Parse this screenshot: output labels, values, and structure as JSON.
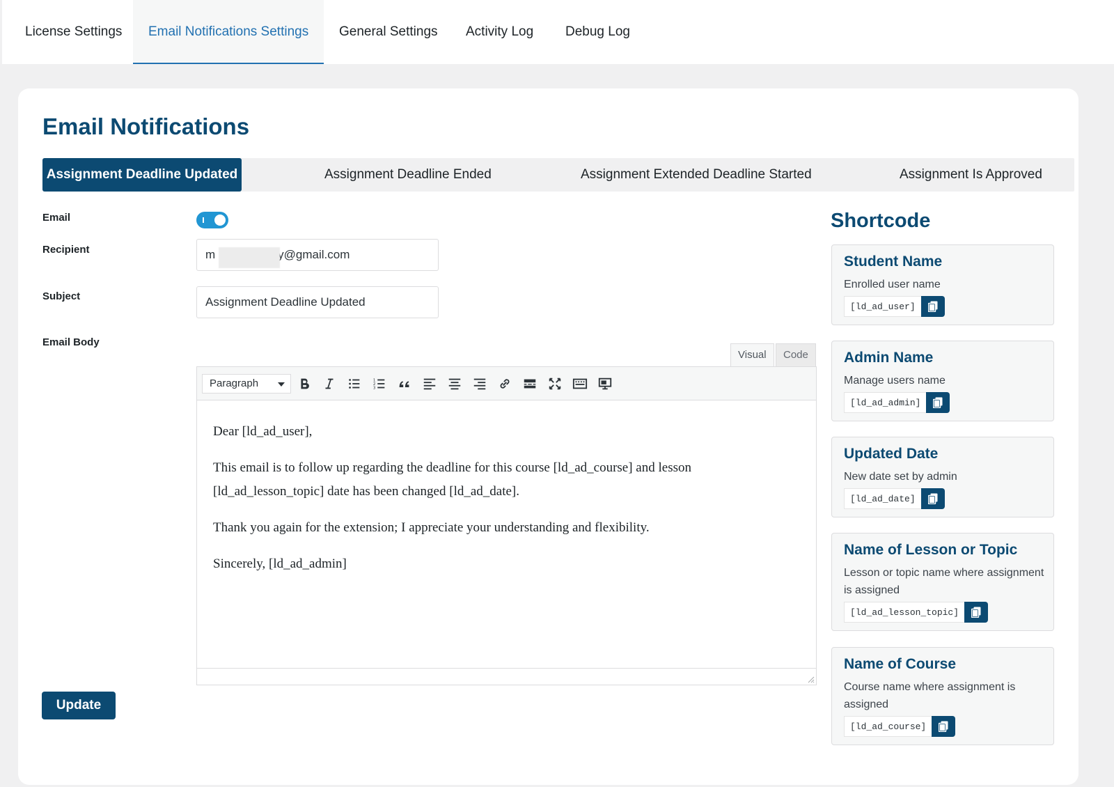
{
  "top_tabs": [
    {
      "label": "License Settings"
    },
    {
      "label": "Email Notifications Settings",
      "active": true
    },
    {
      "label": "General Settings"
    },
    {
      "label": "Activity Log"
    },
    {
      "label": "Debug Log"
    }
  ],
  "page_title": "Email Notifications",
  "notification_tabs": [
    {
      "label": "Assignment Deadline Updated",
      "active": true
    },
    {
      "label": "Assignment Deadline Ended"
    },
    {
      "label": "Assignment Extended Deadline Started"
    },
    {
      "label": "Assignment Is Approved"
    }
  ],
  "form": {
    "email_label": "Email",
    "email_enabled": true,
    "recipient_label": "Recipient",
    "recipient_prefix": "m",
    "recipient_suffix": "y@gmail.com",
    "subject_label": "Subject",
    "subject_value": "Assignment Deadline Updated",
    "body_label": "Email Body"
  },
  "editor": {
    "tab_visual": "Visual",
    "tab_code": "Code",
    "format_select": "Paragraph",
    "toolbar_icons": [
      "bold-icon",
      "italic-icon",
      "bullet-list-icon",
      "numbered-list-icon",
      "blockquote-icon",
      "align-left-icon",
      "align-center-icon",
      "align-right-icon",
      "link-icon",
      "read-more-icon",
      "fullscreen-icon",
      "toolbar-toggle-icon",
      "embed-media-icon"
    ],
    "paragraphs": [
      "Dear [ld_ad_user],",
      "This email is to follow up regarding the deadline for this course [ld_ad_course] and lesson [ld_ad_lesson_topic] date has been changed [ld_ad_date].",
      "Thank you again for the extension; I appreciate your understanding and flexibility.",
      "Sincerely, [ld_ad_admin]"
    ]
  },
  "update_label": "Update",
  "shortcode": {
    "title": "Shortcode",
    "items": [
      {
        "name": "Student Name",
        "desc": "Enrolled user name",
        "code": "[ld_ad_user]"
      },
      {
        "name": "Admin Name",
        "desc": "Manage users name",
        "code": "[ld_ad_admin]"
      },
      {
        "name": "Updated Date",
        "desc": "New date set by admin",
        "code": "[ld_ad_date]"
      },
      {
        "name": "Name of Lesson or Topic",
        "desc": "Lesson or topic name where assignment is assigned",
        "code": "[ld_ad_lesson_topic]"
      },
      {
        "name": "Name of Course",
        "desc": "Course name where assignment is assigned",
        "code": "[ld_ad_course]"
      }
    ]
  },
  "colors": {
    "brand_dark": "#0c4a72",
    "active_tab": "#2271b1",
    "toggle_on": "#2196d3"
  }
}
